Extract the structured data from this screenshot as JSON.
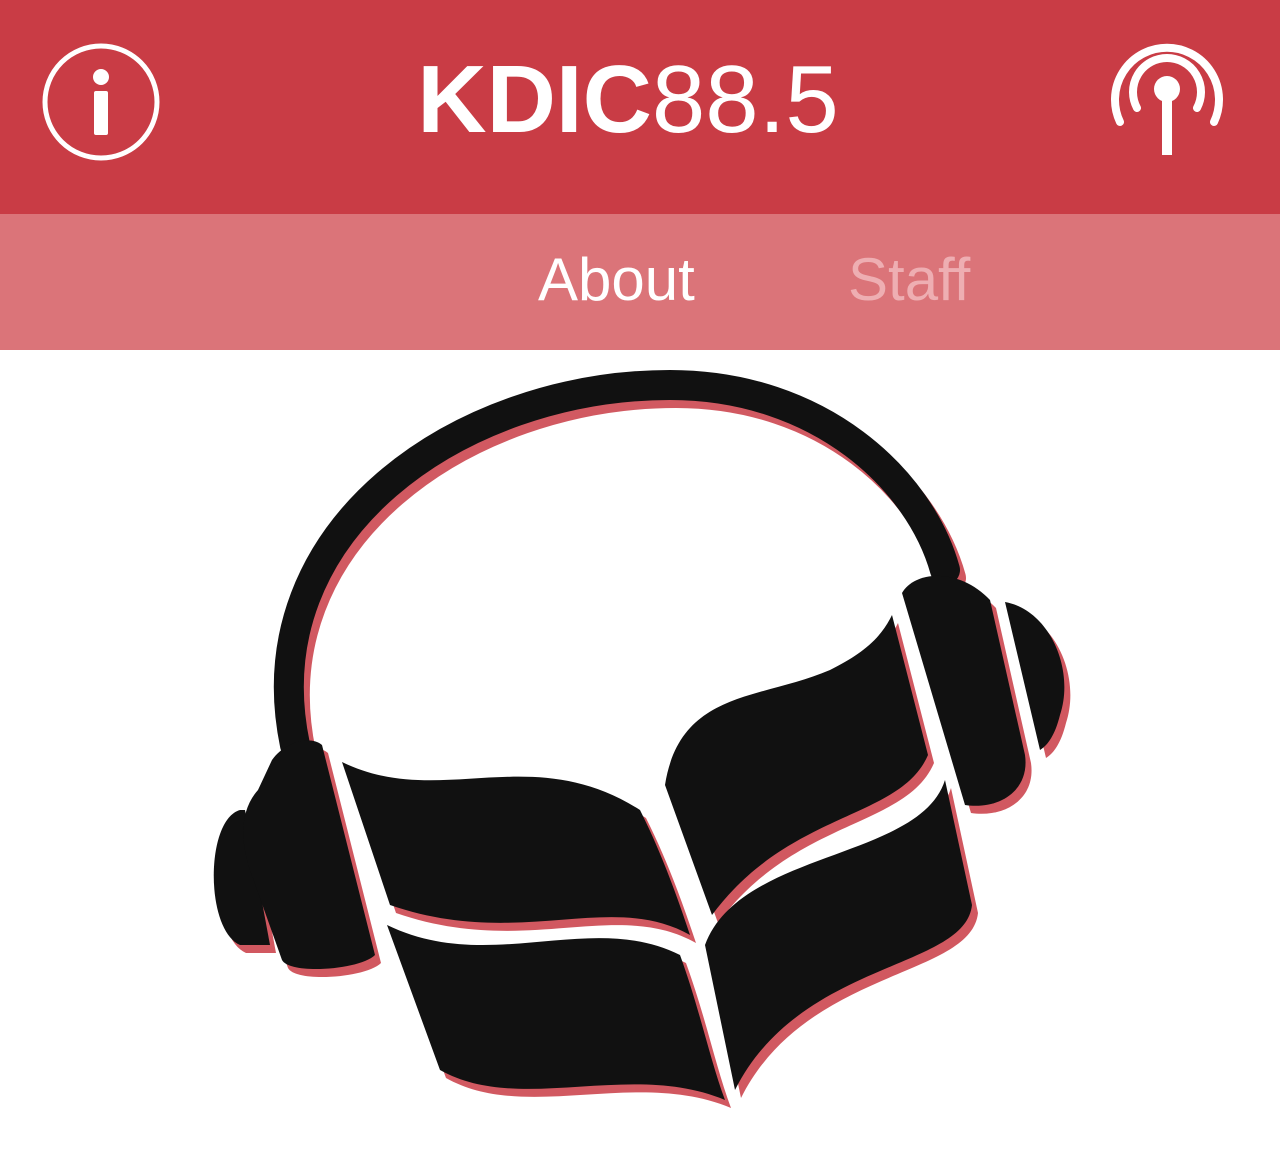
{
  "header": {
    "title_bold": "KDIC",
    "title_light": "88.5",
    "background_color": "#c93c45",
    "info_icon": "info-circle-icon",
    "broadcast_icon": "broadcast-antenna-icon"
  },
  "tabs": {
    "background_color": "#db7479",
    "items": [
      {
        "label": "About",
        "selected": true
      },
      {
        "label": "Staff",
        "selected": false
      }
    ]
  },
  "main": {
    "logo": "headphones-book-logo",
    "logo_shadow_color": "#c93c45"
  }
}
